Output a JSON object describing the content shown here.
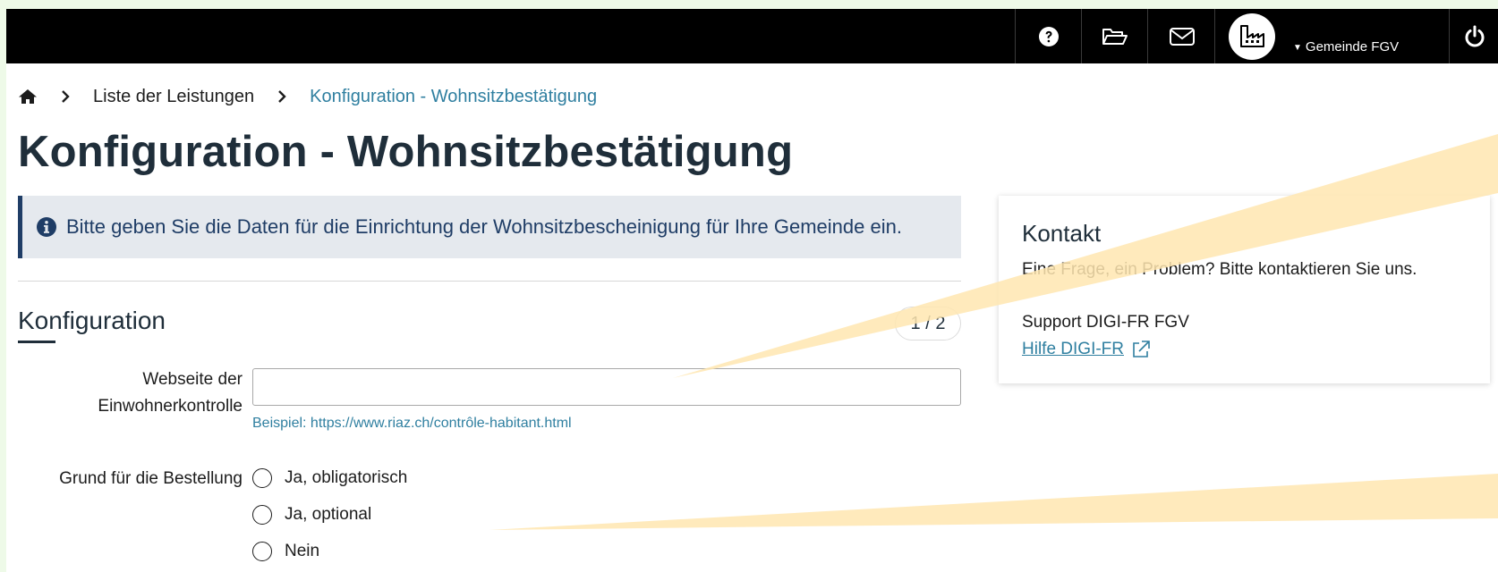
{
  "topbar": {
    "user_menu_label": "Gemeinde FGV"
  },
  "breadcrumb": {
    "items": [
      "Liste der Leistungen",
      "Konfiguration - Wohnsitzbestätigung"
    ]
  },
  "page": {
    "title": "Konfiguration - Wohnsitzbestätigung",
    "info_text": "Bitte geben Sie die Daten für die Einrichtung der Wohnsitzbescheinigung für Ihre Gemeinde ein."
  },
  "section": {
    "title": "Konfiguration",
    "step": "1 / 2"
  },
  "form": {
    "website_label_line1": "Webseite der",
    "website_label_line2": "Einwohnerkontrolle",
    "website_value": "",
    "website_hint": "Beispiel: https://www.riaz.ch/contrôle-habitant.html",
    "reason_label": "Grund für die Bestellung",
    "reason_options": [
      "Ja, obligatorisch",
      "Ja, optional",
      "Nein"
    ]
  },
  "contact": {
    "title": "Kontakt",
    "text": "Eine Frage, ein Problem? Bitte kontaktieren Sie uns.",
    "support_label": "Support DIGI-FR FGV",
    "link_label": "Hilfe DIGI-FR"
  },
  "colors": {
    "topbar": "#000000",
    "accent_link": "#2f7fa0",
    "info_border": "#1f3d66",
    "info_bg": "#e5e9ee",
    "beam": "#ffe6b0"
  }
}
